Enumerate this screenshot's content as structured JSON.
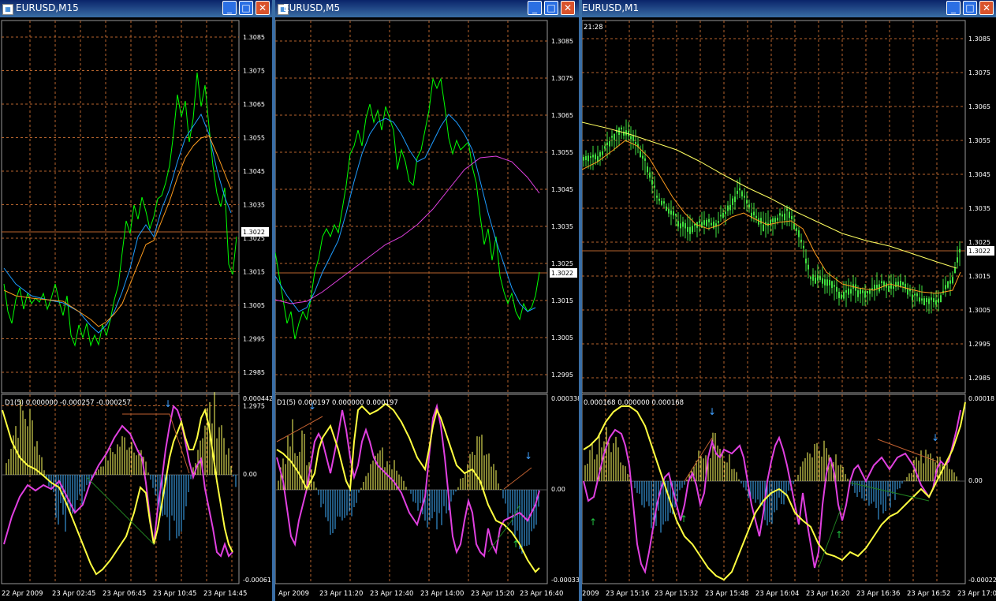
{
  "windows": [
    {
      "id": "w1",
      "title": "EURUSD,M15",
      "price_ticks": [
        "1.3085",
        "1.3075",
        "1.3065",
        "1.3055",
        "1.3045",
        "1.3035",
        "1.3025",
        "1.3015",
        "1.3005",
        "1.2995",
        "1.2985",
        "1.2975"
      ],
      "current_price": "1.3022",
      "indicator_label": "D1(5) 0.000000 -0.000257 -0.000257",
      "indicator_ticks": [
        "0.000442",
        "0.00",
        "-0.00061"
      ],
      "time_labels": [
        "22 Apr 2009",
        "23 Apr 02:45",
        "23 Apr 06:45",
        "23 Apr 10:45",
        "23 Apr 14:45"
      ]
    },
    {
      "id": "w2",
      "title": "EURUSD,M5",
      "price_ticks": [
        "1.3085",
        "1.3075",
        "1.3065",
        "1.3055",
        "1.3045",
        "1.3035",
        "1.3025",
        "1.3015",
        "1.3005",
        "1.2995"
      ],
      "current_price": "1.3022",
      "indicator_label": "D1(5) 0.000197 0.000000 0.000197",
      "indicator_ticks": [
        "0.000338",
        "0.00",
        "-0.00033"
      ],
      "time_labels": [
        "Apr 2009",
        "23 Apr 11:20",
        "23 Apr 12:40",
        "23 Apr 14:00",
        "23 Apr 15:20",
        "23 Apr 16:40"
      ]
    },
    {
      "id": "w3",
      "title": "EURUSD,M1",
      "price_ticks": [
        "1.3085",
        "1.3075",
        "1.3065",
        "1.3055",
        "1.3045",
        "1.3035",
        "1.3025",
        "1.3015",
        "1.3005",
        "1.2995",
        "1.2985"
      ],
      "current_price": "1.3022",
      "corner_time": "21:28",
      "indicator_label": "0.000168 0.000000 0.000168",
      "indicator_ticks": [
        "0.00018",
        "0.00",
        "-0.00022"
      ],
      "time_labels": [
        "2009",
        "23 Apr 15:16",
        "23 Apr 15:32",
        "23 Apr 15:48",
        "23 Apr 16:04",
        "23 Apr 16:20",
        "23 Apr 16:36",
        "23 Apr 16:52",
        "23 Apr 17:0"
      ]
    }
  ],
  "window_buttons": {
    "minimize": "_",
    "maximize": "□",
    "close": "✕"
  },
  "colors": {
    "background": "#000000",
    "grid": "#b8652e",
    "price_line": "#00ff00",
    "ma_fast": "#1e9cff",
    "ma_slow": "#ff9c1e",
    "ma_magenta": "#e040e0",
    "ma_yellow": "#ffff40",
    "hist_pos": "#ffff60",
    "hist_neg": "#40b0ff"
  }
}
